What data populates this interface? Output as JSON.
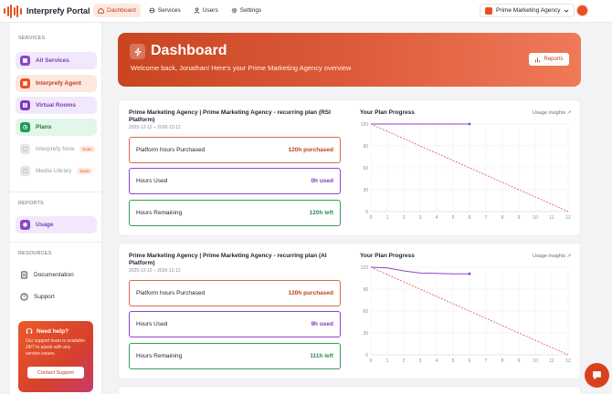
{
  "app": {
    "title": "Interprefy Portal"
  },
  "nav": [
    {
      "label": "Dashboard",
      "icon": "home-icon",
      "active": true
    },
    {
      "label": "Services",
      "icon": "services-icon",
      "active": false
    },
    {
      "label": "Users",
      "icon": "user-icon",
      "active": false
    },
    {
      "label": "Settings",
      "icon": "gear-icon",
      "active": false
    }
  ],
  "org": {
    "name": "Prime Marketing Agency"
  },
  "sidebar": {
    "services_label": "SERVICES",
    "items": [
      {
        "label": "All Services",
        "color": "#8a46c9",
        "bg": "#f1e8fb"
      },
      {
        "label": "Interprefy Agent",
        "color": "#e8501f",
        "bg": "#fde8e0"
      },
      {
        "label": "Virtual Rooms",
        "color": "#7c3bbd",
        "bg": "#f1e8fb"
      },
      {
        "label": "Plans",
        "color": "#1f9d55",
        "bg": "#e2f6ea"
      },
      {
        "label": "Interprefy Now",
        "soon": "Soon"
      },
      {
        "label": "Media Library",
        "soon": "Soon"
      }
    ],
    "reports_label": "REPORTS",
    "usage_label": "Usage",
    "resources_label": "RESOURCES",
    "documentation_label": "Documentation",
    "support_label": "Support",
    "help": {
      "title": "Need help?",
      "text": "Our support team is available 24/7 to assist with any service issues.",
      "button": "Contact Support"
    }
  },
  "hero": {
    "title": "Dashboard",
    "subtitle": "Welcome back, Jonathan! Here's your Prime Marketing Agency overview",
    "reports_button": "Reports"
  },
  "plans": [
    {
      "title": "Prime Marketing Agency | Prime Marketing Agency - recurring plan (RSI Platform)",
      "dates": "2025-12-12 – 2026-12-12",
      "purchased_label": "Platform hours Purchased",
      "purchased_value": "120h purchased",
      "used_label": "Hours Used",
      "used_value": "0h used",
      "remaining_label": "Hours Remaining",
      "remaining_value": "120h left",
      "progress_title": "Your Plan Progress",
      "insights_label": "Usage insights ↗"
    },
    {
      "title": "Prime Marketing Agency | Prime Marketing Agency - recurring plan (AI Platform)",
      "dates": "2025-12-12 – 2026-12-12",
      "purchased_label": "Platform hours Purchased",
      "purchased_value": "120h purchased",
      "used_label": "Hours Used",
      "used_value": "9h used",
      "remaining_label": "Hours Remaining",
      "remaining_value": "111h left",
      "progress_title": "Your Plan Progress",
      "insights_label": "Usage insights ↗"
    }
  ],
  "chart_data": [
    {
      "type": "line",
      "x": [
        0,
        1,
        2,
        3,
        4,
        5,
        6,
        7,
        8,
        9,
        10,
        11,
        12
      ],
      "ylim": [
        0,
        120
      ],
      "yticks": [
        0,
        30,
        60,
        90,
        120
      ],
      "series": [
        {
          "values": [
            120,
            120,
            120,
            120,
            120,
            120,
            120
          ],
          "color": "#8a46c9",
          "style": "solid"
        },
        {
          "values": [
            120,
            110,
            100,
            90,
            80,
            70,
            60,
            50,
            40,
            30,
            20,
            10,
            0
          ],
          "color": "#e04d6a",
          "style": "dashed"
        }
      ],
      "grid": true
    },
    {
      "type": "line",
      "x": [
        0,
        1,
        2,
        3,
        4,
        5,
        6,
        7,
        8,
        9,
        10,
        11,
        12
      ],
      "ylim": [
        0,
        120
      ],
      "yticks": [
        0,
        30,
        60,
        90,
        120
      ],
      "series": [
        {
          "values": [
            120,
            119,
            115,
            112,
            111.5,
            111,
            111
          ],
          "color": "#8a46c9",
          "style": "solid"
        },
        {
          "values": [
            120,
            110,
            100,
            90,
            80,
            70,
            60,
            50,
            40,
            30,
            20,
            10,
            0
          ],
          "color": "#e04d6a",
          "style": "dashed"
        }
      ],
      "grid": true
    }
  ]
}
